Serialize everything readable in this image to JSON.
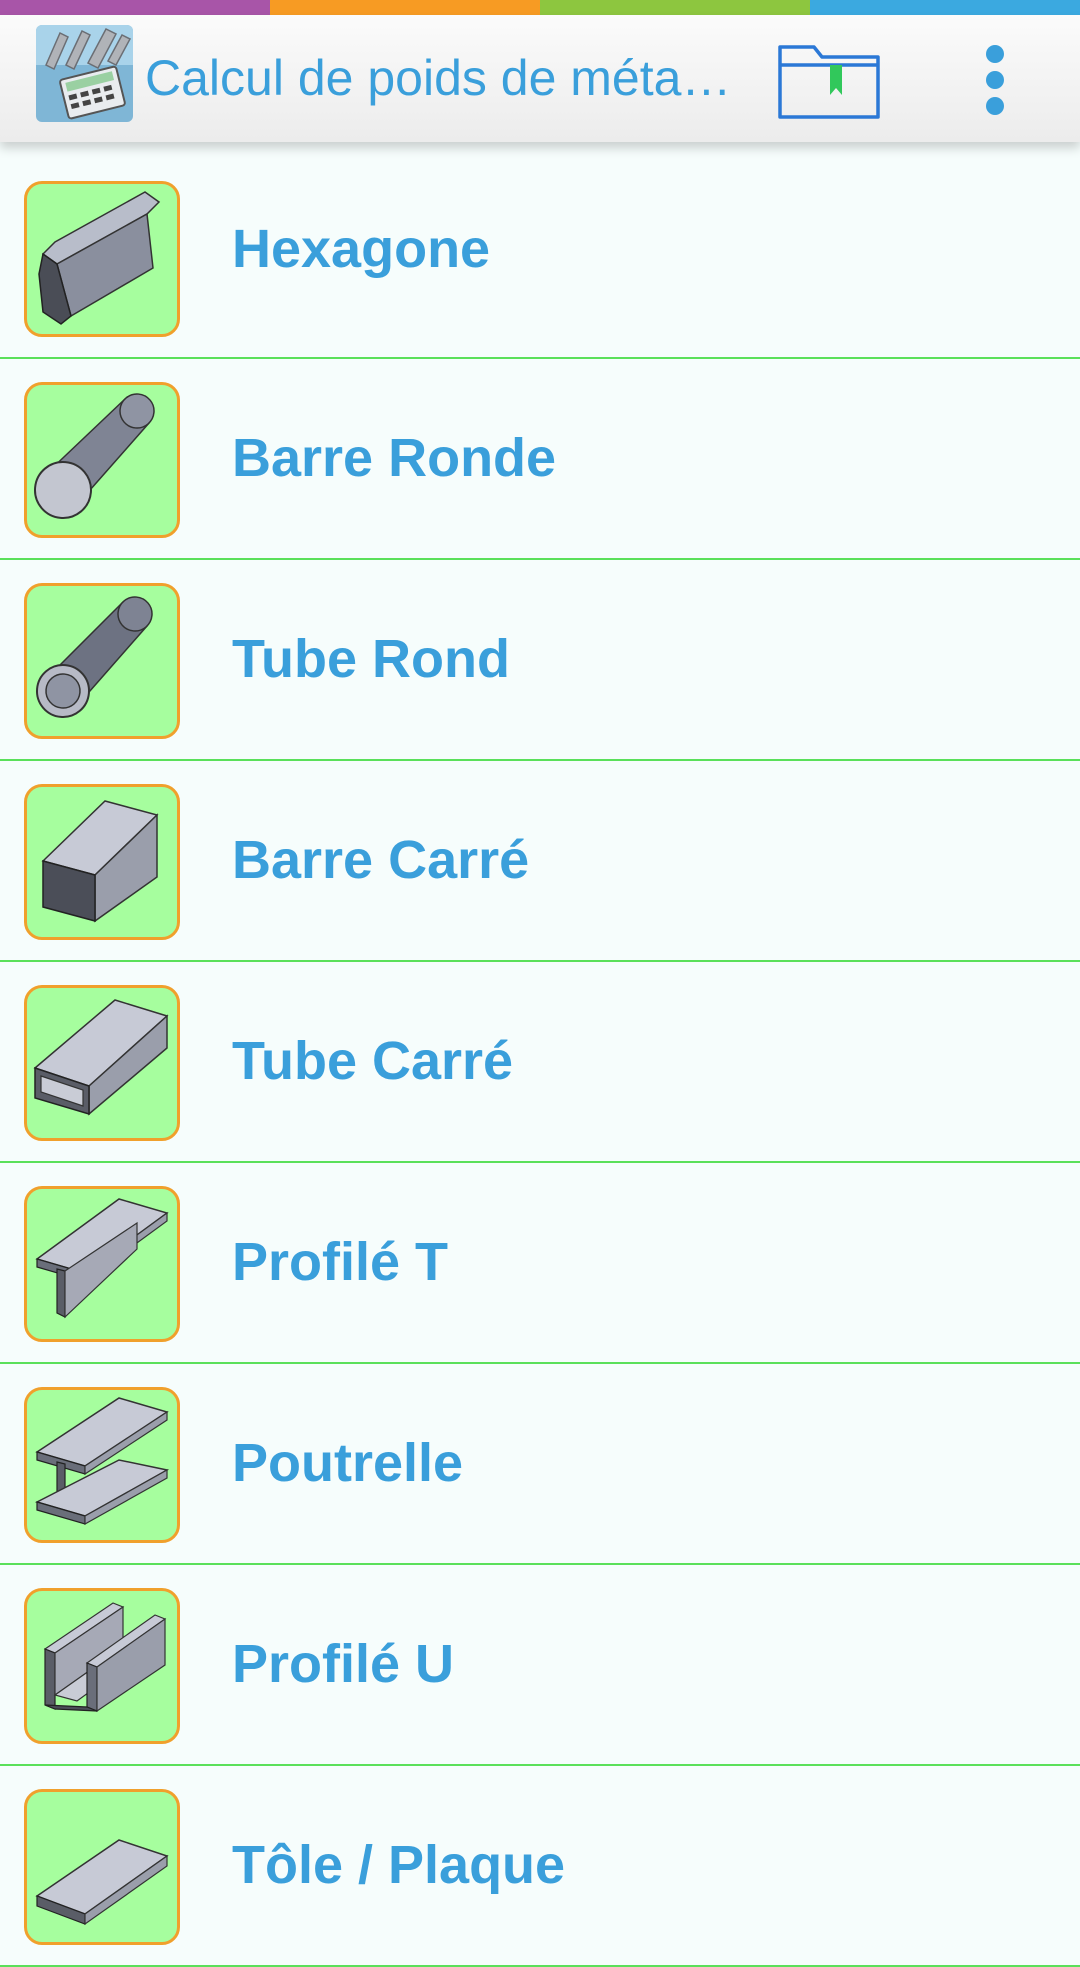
{
  "strip_colors": [
    "#a855a8",
    "#f79b23",
    "#8dc63f",
    "#3ba9e0"
  ],
  "header": {
    "title": "Calcul de poids de méta…",
    "app_icon": "metal-calculator-icon",
    "folder_icon": "bookmark-folder-icon",
    "menu_icon": "overflow-menu-icon"
  },
  "items": [
    {
      "label": "Hexagone",
      "icon": "hexagon-bar-icon"
    },
    {
      "label": "Barre Ronde",
      "icon": "round-bar-icon"
    },
    {
      "label": "Tube Rond",
      "icon": "round-tube-icon"
    },
    {
      "label": "Barre Carré",
      "icon": "square-bar-icon"
    },
    {
      "label": "Tube Carré",
      "icon": "square-tube-icon"
    },
    {
      "label": "Profilé T",
      "icon": "t-profile-icon"
    },
    {
      "label": "Poutrelle",
      "icon": "i-beam-icon"
    },
    {
      "label": "Profilé U",
      "icon": "u-profile-icon"
    },
    {
      "label": "Tôle / Plaque",
      "icon": "sheet-plate-icon"
    }
  ],
  "colors": {
    "accent": "#3a9fdb",
    "thumb_bg": "#a6fe9e",
    "thumb_border": "#f0a02c",
    "divider": "#5ae05a"
  }
}
